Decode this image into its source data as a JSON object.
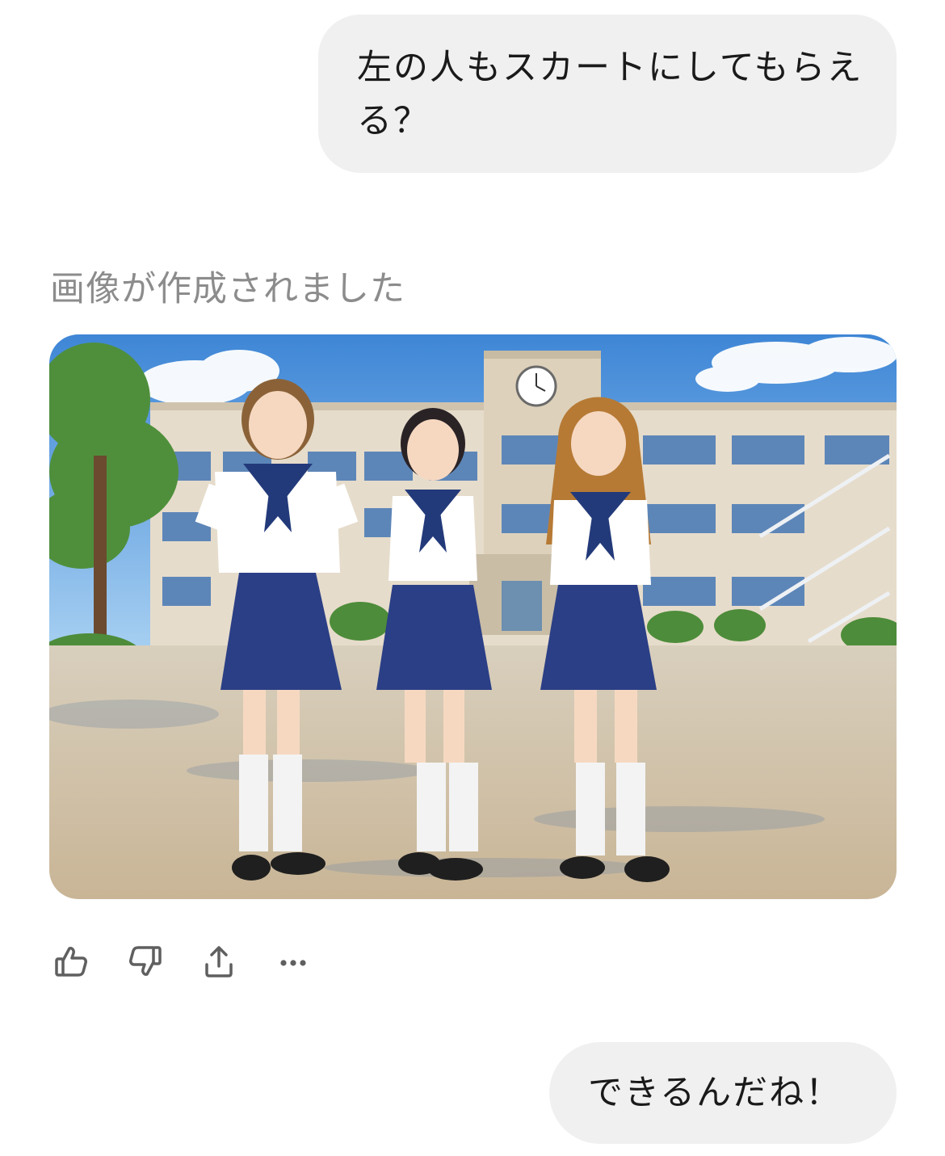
{
  "messages": {
    "user_1": "左の人もスカートにしてもらえる？",
    "assistant_status": "画像が作成されました",
    "user_2": "できるんだね！"
  },
  "image": {
    "icon": "generated-image"
  },
  "actions": [
    {
      "icon": "thumbs-up-icon"
    },
    {
      "icon": "thumbs-down-icon"
    },
    {
      "icon": "share-icon"
    },
    {
      "icon": "more-icon"
    }
  ],
  "colors": {
    "bubble_bg": "#f0f0f0",
    "status_text": "#8c8c8c",
    "icon": "#5f5f5f"
  }
}
